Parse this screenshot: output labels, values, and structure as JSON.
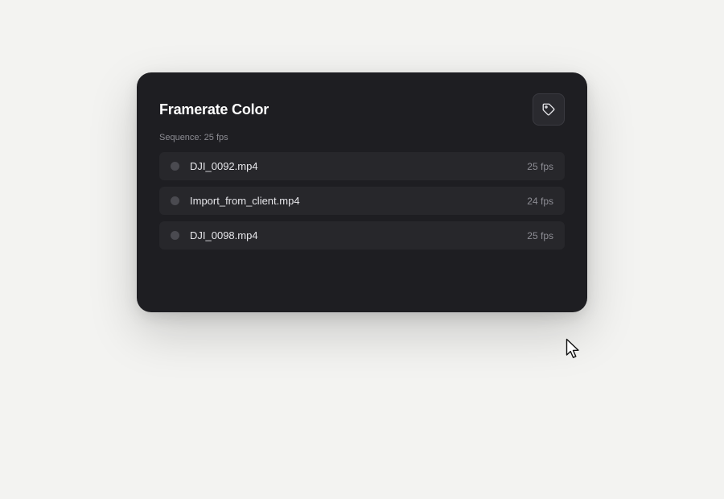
{
  "card": {
    "title": "Framerate Color",
    "subtitle": "Sequence: 25 fps",
    "tag_button_icon": "tag-icon",
    "clips": [
      {
        "name": "DJI_0092.mp4",
        "fps": "25 fps"
      },
      {
        "name": "Import_from_client.mp4",
        "fps": "24 fps"
      },
      {
        "name": "DJI_0098.mp4",
        "fps": "25 fps"
      }
    ]
  },
  "colors": {
    "card_background": "#1e1e22",
    "row_background": "#27272b",
    "page_background": "#f3f3f1",
    "dot": "#4a4a50"
  }
}
